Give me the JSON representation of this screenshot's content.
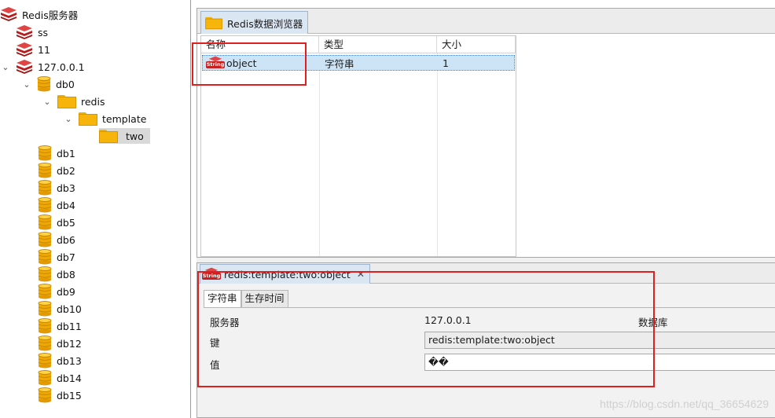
{
  "tree": {
    "root": "Redis服务器",
    "servers": [
      "ss",
      "11",
      "127.0.0.1"
    ],
    "db0": "db0",
    "folder_redis": "redis",
    "folder_template": "template",
    "folder_two": "two",
    "databases": [
      "db1",
      "db2",
      "db3",
      "db4",
      "db5",
      "db6",
      "db7",
      "db8",
      "db9",
      "db10",
      "db11",
      "db12",
      "db13",
      "db14",
      "db15"
    ]
  },
  "browser": {
    "tab_label": "Redis数据浏览器",
    "columns": [
      "名称",
      "类型",
      "大小"
    ],
    "row": {
      "name": "object",
      "type": "字符串",
      "size": "1"
    }
  },
  "detail": {
    "tab_label": "redis:template:two:object",
    "close_glyph": "✕",
    "subtabs": [
      "字符串",
      "生存时间"
    ],
    "server_label": "服务器",
    "server_value": "127.0.0.1",
    "database_label": "数据库",
    "key_label": "键",
    "key_value": "redis:template:two:object",
    "value_label": "值",
    "value_value": "��"
  },
  "watermark": "https://blog.csdn.net/qq_36654629",
  "icon_tag": "String",
  "colors": {
    "annotation": "#e02020",
    "selection": "#cde4f7",
    "folder": "#f7b40b",
    "redis_red": "#c62020"
  },
  "icons": {
    "server": "redis-cube-icon",
    "database": "database-icon",
    "folder": "folder-icon",
    "string_key": "string-key-icon"
  }
}
